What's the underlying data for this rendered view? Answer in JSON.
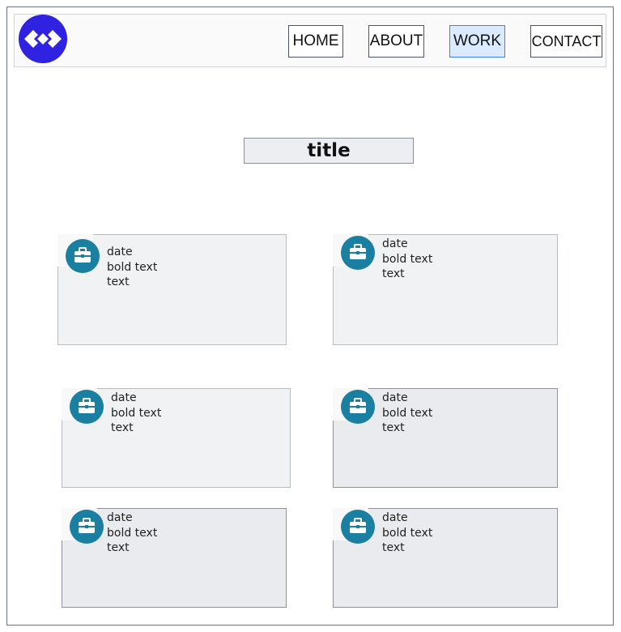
{
  "nav": {
    "items": [
      {
        "label": "HOME"
      },
      {
        "label": "ABOUT"
      },
      {
        "label": "WORK"
      },
      {
        "label": "CONTACT"
      }
    ],
    "active": "WORK"
  },
  "logo": {
    "icon": "logo-diamond-arrows-icon",
    "color": "#2f22e0"
  },
  "page": {
    "title": "title"
  },
  "cards": [
    {
      "icon": "briefcase-icon",
      "date": "date",
      "bold": "bold text",
      "text": "text"
    },
    {
      "icon": "briefcase-icon",
      "date": "date",
      "bold": "bold text",
      "text": "text"
    },
    {
      "icon": "briefcase-icon",
      "date": "date",
      "bold": "bold text",
      "text": "text"
    },
    {
      "icon": "briefcase-icon",
      "date": "date",
      "bold": "bold text",
      "text": "text"
    },
    {
      "icon": "briefcase-icon",
      "date": "date",
      "bold": "bold text",
      "text": "text"
    },
    {
      "icon": "briefcase-icon",
      "date": "date",
      "bold": "bold text",
      "text": "text"
    }
  ],
  "colors": {
    "accent": "#1a7fa0",
    "active_nav": "#dbeafe",
    "logo": "#2f22e0"
  }
}
